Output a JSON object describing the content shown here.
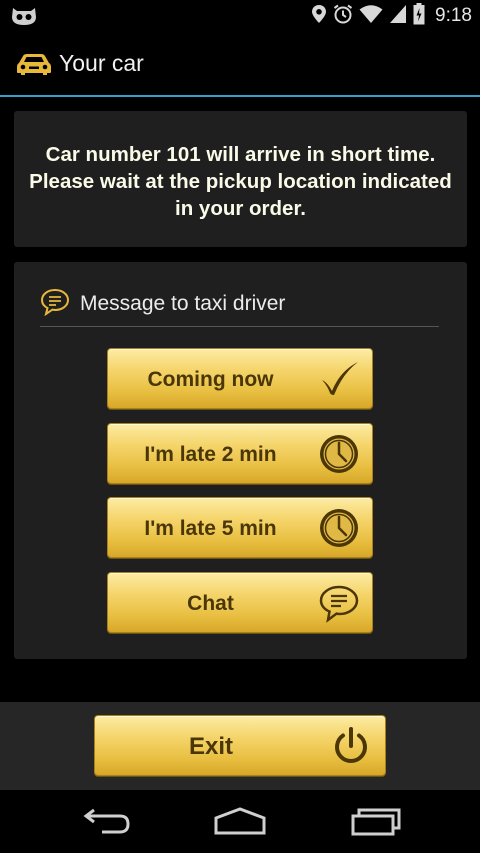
{
  "status_bar": {
    "time": "9:18",
    "icons": [
      "cyanogen-mod-icon",
      "location-pin-icon",
      "alarm-icon",
      "wifi-icon",
      "signal-icon",
      "battery-icon"
    ]
  },
  "action_bar": {
    "title": "Your car",
    "icon": "car-icon"
  },
  "info": {
    "line1": "Car number 101 will arrive in short time.",
    "line2": "Please wait at the pickup location indicated",
    "line3": "in your order."
  },
  "message_section": {
    "header": "Message to taxi driver",
    "icon": "speech-bubble-icon",
    "buttons": [
      {
        "label": "Coming now",
        "icon": "checkmark-icon"
      },
      {
        "label": "I'm late 2 min",
        "icon": "clock-icon"
      },
      {
        "label": "I'm late 5 min",
        "icon": "clock-icon"
      },
      {
        "label": "Chat",
        "icon": "chat-bubble-icon"
      }
    ]
  },
  "exit_button": {
    "label": "Exit",
    "icon": "power-icon"
  },
  "nav_bar": {
    "buttons": [
      "back-icon",
      "home-icon",
      "recent-apps-icon"
    ]
  },
  "colors": {
    "accent_line": "#38a0c8",
    "button_gold": "#f5d56c",
    "button_text": "#4a3606",
    "panel_bg": "#1f1f1f"
  }
}
